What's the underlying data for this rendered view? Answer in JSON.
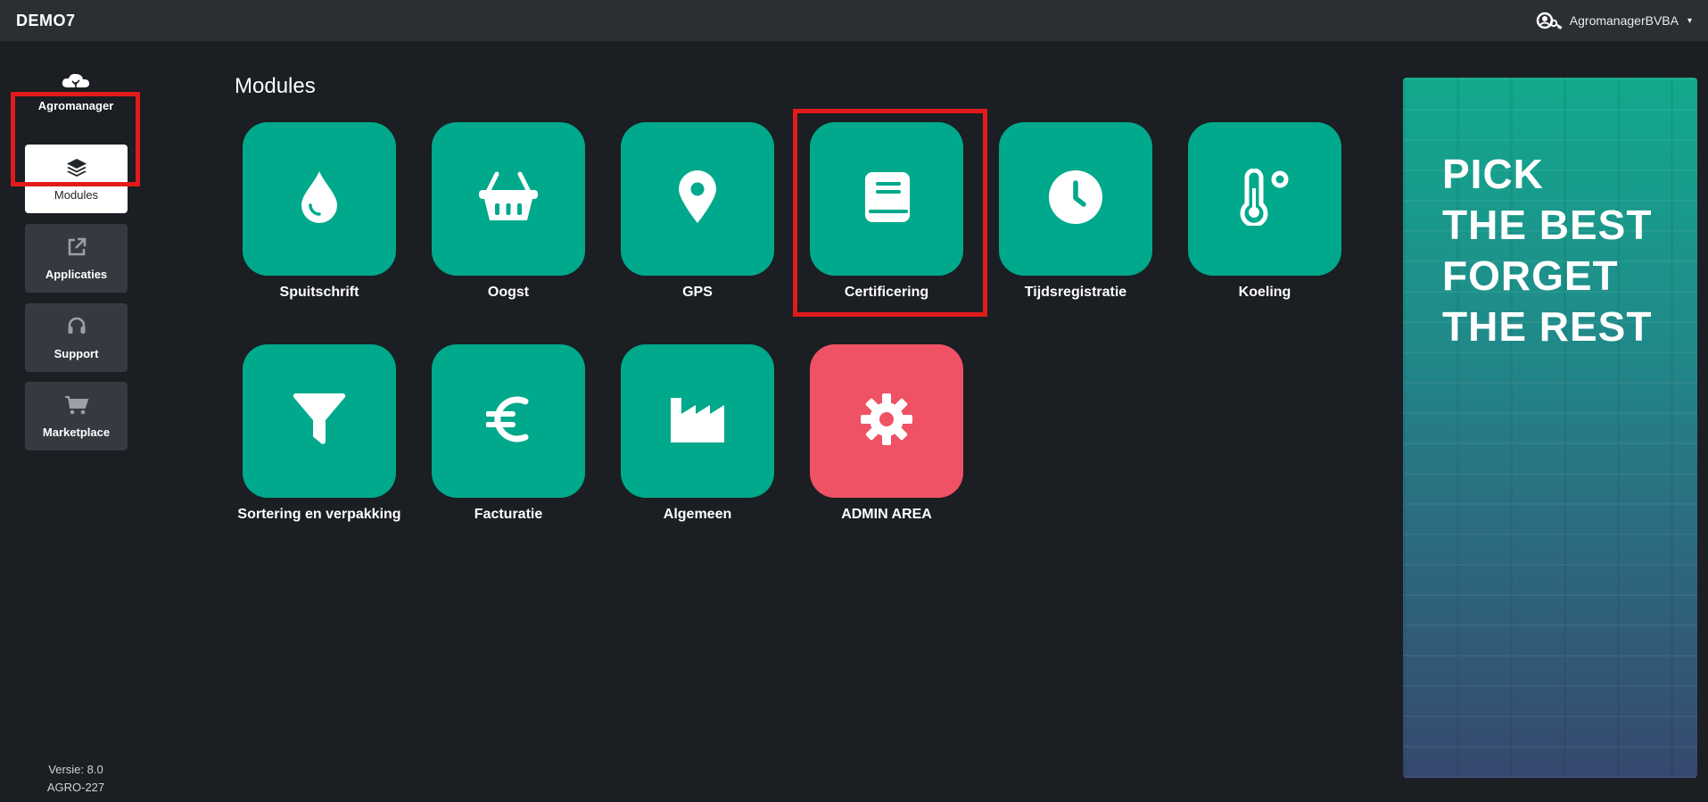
{
  "app": {
    "title": "DEMO7"
  },
  "user": {
    "name": "AgromanagerBVBA",
    "icon": "user-key-icon"
  },
  "sidebar": {
    "logo_text": "Agromanager",
    "items": [
      {
        "label": "Modules",
        "icon": "layers-icon",
        "active": true
      },
      {
        "label": "Applicaties",
        "icon": "external-link-icon"
      },
      {
        "label": "Support",
        "icon": "headset-icon"
      },
      {
        "label": "Marketplace",
        "icon": "cart-icon"
      }
    ],
    "version_line1": "Versie: 8.0",
    "version_line2": "AGRO-227"
  },
  "main": {
    "title": "Modules",
    "modules": [
      {
        "label": "Spuitschrift",
        "icon": "droplet-icon",
        "color": "#00a98b"
      },
      {
        "label": "Oogst",
        "icon": "basket-icon",
        "color": "#00a98b"
      },
      {
        "label": "GPS",
        "icon": "map-pin-icon",
        "color": "#00a98b"
      },
      {
        "label": "Certificering",
        "icon": "book-icon",
        "color": "#00a98b"
      },
      {
        "label": "Tijdsregistratie",
        "icon": "clock-icon",
        "color": "#00a98b"
      },
      {
        "label": "Koeling",
        "icon": "thermometer-icon",
        "color": "#00a98b"
      },
      {
        "label": "Sortering en verpakking",
        "icon": "filter-icon",
        "color": "#00a98b"
      },
      {
        "label": "Facturatie",
        "icon": "euro-icon",
        "color": "#00a98b"
      },
      {
        "label": "Algemeen",
        "icon": "industry-icon",
        "color": "#00a98b"
      },
      {
        "label": "ADMIN AREA",
        "icon": "gear-icon",
        "color": "#ef5265"
      }
    ]
  },
  "banner": {
    "lines": [
      "PICK",
      "THE BEST",
      "FORGET",
      "THE REST"
    ]
  },
  "colors": {
    "accent": "#00a98b",
    "admin": "#ef5265",
    "highlight": "#e11b1b",
    "background": "#1b1e22",
    "topbar": "#2b2f34"
  }
}
